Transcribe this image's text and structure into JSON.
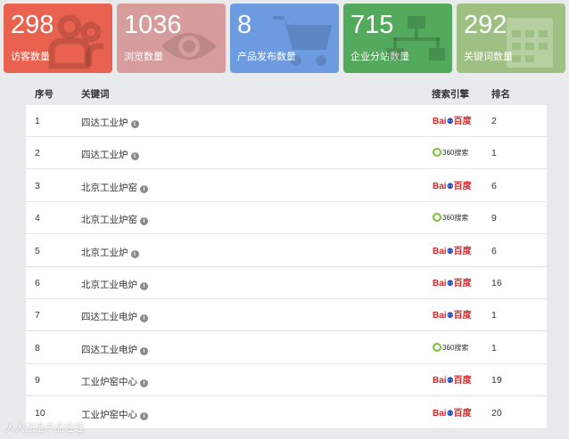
{
  "stats": [
    {
      "value": "298",
      "label": "访客数量",
      "color": "#e8624f",
      "icon": "users-icon"
    },
    {
      "value": "1036",
      "label": "浏览数量",
      "color": "#d79c9c",
      "icon": "eye-icon"
    },
    {
      "value": "8",
      "label": "产品发布数量",
      "color": "#6d9be0",
      "icon": "cart-icon"
    },
    {
      "value": "715",
      "label": "企业分站数量",
      "color": "#54aa5c",
      "icon": "sitemap-icon"
    },
    {
      "value": "292",
      "label": "关键词数量",
      "color": "#9ec183",
      "icon": "calendar-icon"
    }
  ],
  "table": {
    "headers": {
      "index": "序号",
      "keyword": "关键词",
      "engine": "搜索引擎",
      "rank": "排名"
    },
    "rows": [
      {
        "index": "1",
        "keyword": "四达工业炉",
        "engine": "baidu",
        "rank": "2"
      },
      {
        "index": "2",
        "keyword": "四达工业炉",
        "engine": "360",
        "rank": "1"
      },
      {
        "index": "3",
        "keyword": "北京工业炉窑",
        "engine": "baidu",
        "rank": "6"
      },
      {
        "index": "4",
        "keyword": "北京工业炉窑",
        "engine": "360",
        "rank": "9"
      },
      {
        "index": "5",
        "keyword": "北京工业炉",
        "engine": "baidu",
        "rank": "6"
      },
      {
        "index": "6",
        "keyword": "北京工业电炉",
        "engine": "baidu",
        "rank": "16"
      },
      {
        "index": "7",
        "keyword": "四达工业电炉",
        "engine": "baidu",
        "rank": "1"
      },
      {
        "index": "8",
        "keyword": "四达工业电炉",
        "engine": "360",
        "rank": "1"
      },
      {
        "index": "9",
        "keyword": "工业炉窑中心",
        "engine": "baidu",
        "rank": "19"
      },
      {
        "index": "10",
        "keyword": "工业炉窑中心",
        "engine": "baidu",
        "rank": "20"
      }
    ]
  },
  "engine_logos": {
    "baidu": {
      "left": "Bai",
      "right": "百度"
    },
    "360": {
      "text": "360搜索"
    }
  },
  "watermark": "人人都是产品经理"
}
